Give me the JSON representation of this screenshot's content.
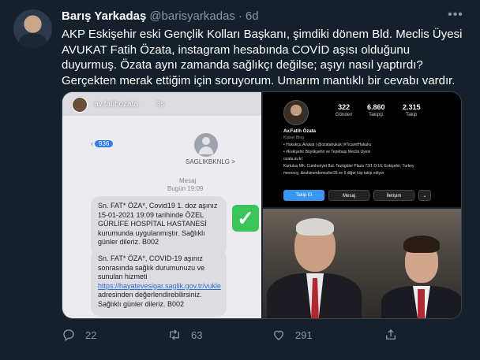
{
  "tweet": {
    "author_name": "Barış Yarkadaş",
    "author_handle": "@barisyarkadas",
    "separator": "·",
    "time": "6d",
    "more_icon": "more-horizontal-icon",
    "text": "AKP Eskişehir eski Gençlik Kolları Başkanı, şimdiki dönem Bld. Meclis Üyesi AVUKAT Fatih Özata, instagram hesabında COVİD aşısı olduğunu duyurmuş. Özata aynı zamanda sağlıkçı değilse; aşıyı nasıl yaptırdı? Gerçekten merak ettiğim için soruyorum. Umarım mantıklı bir cevabı vardır."
  },
  "media": {
    "sms_screenshot": {
      "story_user": "av.fatihozata",
      "story_time": "3s",
      "back_count": "936",
      "contact": "SAGLIKBKNLG >",
      "meta_label": "Mesaj",
      "meta_date": "Bugün 19:09",
      "message1": "Sn. FAT* ÖZA*, Covid19 1. doz aşınız 15-01-2021 19:09 tarihinde ÖZEL GÜRLİFE HOSPİTAL HASTANESİ kurumunda uygulanmıştır. Sağlıklı günler dileriz.   B002",
      "message2_pre": "Sn. FAT* ÖZA*, COVID-19 aşınız sonrasında sağlık durumunuzu ve sunulan hizmeti ",
      "message2_link": "https://hayatevesigar.saglik.gov.tr/vukle",
      "message2_post": " adresinden değerlendirebilirsiniz. Sağlıklı günler dileriz.  B002",
      "check_glyph": "✓"
    },
    "instagram_profile": {
      "posts": "322",
      "posts_label": "Gönderi",
      "followers": "6.860",
      "followers_label": "Takipçi",
      "following": "2.315",
      "following_label": "Takip",
      "name": "Av.Fatih Özata",
      "subtitle": "Kişisel Blog",
      "bio_lines": [
        "• Hukukçu,Avukat | @ozatahukuk |#TicaretHukuku",
        "• #Eskişehir Büyükşehir ve Tepebaşı Meclis Üyesi",
        "ozata.av.tr/",
        "Kurtuluş Mh. Cumhuriyet Bul. Tezügüler Plaza 73/1 D:16, Eskişehir, Turkey",
        "meersoy, ibrahimerdemozler26 ve 5 diğer kişi takip ediyor"
      ],
      "follow_button": "Takip Et",
      "message_button": "Mesaj",
      "contact_button": "İletişim",
      "more_button": "⌄"
    }
  },
  "actions": {
    "reply_count": "22",
    "retweet_count": "63",
    "like_count": "291",
    "reply_icon": "reply-icon",
    "retweet_icon": "retweet-icon",
    "like_icon": "heart-icon",
    "share_icon": "share-icon"
  }
}
